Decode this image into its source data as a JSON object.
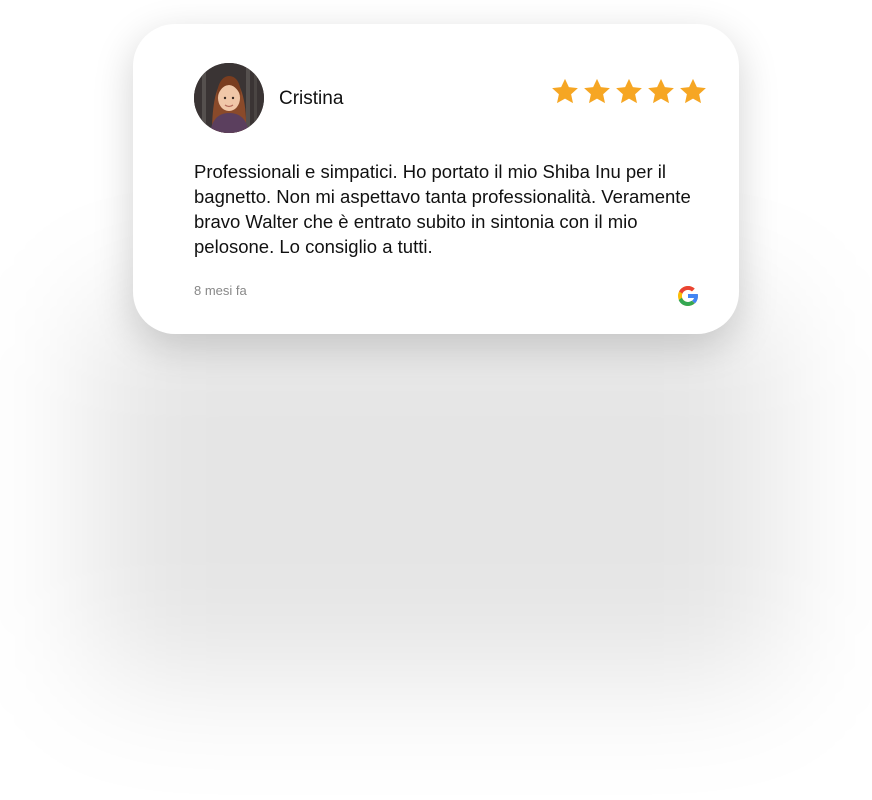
{
  "review": {
    "reviewer_name": "Cristina",
    "rating": 5,
    "rating_max": 5,
    "text": "Professionali e simpatici. Ho portato il mio Shiba Inu per il bagnetto. Non mi aspettavo tanta professionalità. Veramente bravo Walter che è entrato subito in sintonia con il mio pelosone. Lo consiglio a tutti.",
    "time_ago": "8 mesi fa",
    "source_icon": "google-icon"
  },
  "colors": {
    "star": "#F6A623",
    "card_background": "#FFFFFF",
    "text": "#111111",
    "muted_text": "#888888",
    "google_blue": "#4285F4",
    "google_red": "#EA4335",
    "google_yellow": "#FBBC05",
    "google_green": "#34A853"
  }
}
